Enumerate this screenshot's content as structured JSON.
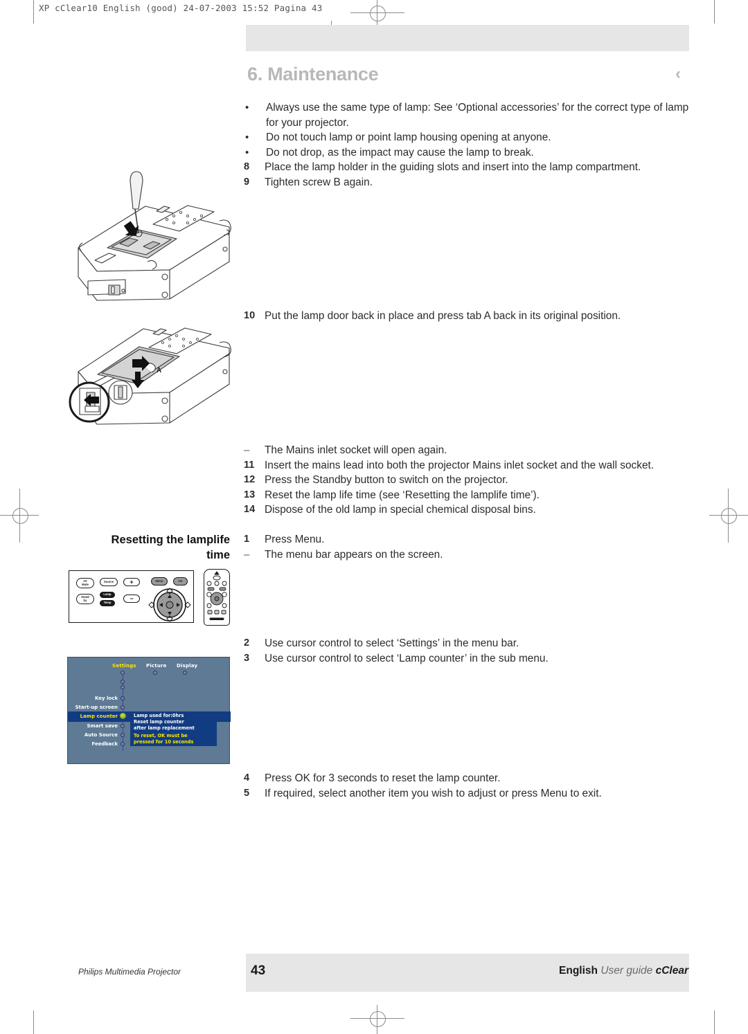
{
  "prepress": {
    "header": "XP cClear10 English (good)  24-07-2003  15:52  Pagina 43"
  },
  "chapter": {
    "title": "6. Maintenance",
    "arrow": "‹"
  },
  "steps_top": [
    {
      "marker": "•",
      "type": "bullet",
      "text": "Always use the same type of lamp: See ‘Optional accessories’ for the correct type of lamp for your projector."
    },
    {
      "marker": "•",
      "type": "bullet",
      "text": "Do not touch lamp or point lamp housing opening at anyone."
    },
    {
      "marker": "•",
      "type": "bullet",
      "text": "Do not drop, as the impact may cause the lamp to break."
    },
    {
      "marker": "8",
      "type": "num",
      "text": "Place the lamp holder in the guiding slots and insert into the lamp compartment."
    },
    {
      "marker": "9",
      "type": "num",
      "text": "Tighten screw B again."
    }
  ],
  "steps_mid": [
    {
      "marker": "10",
      "type": "num",
      "text": "Put the lamp door back in place and press tab A back in its original position."
    }
  ],
  "steps_lower": [
    {
      "marker": "–",
      "type": "dash",
      "text": "The Mains inlet socket will open again."
    },
    {
      "marker": "11",
      "type": "num",
      "text": "Insert the mains lead into both the projector Mains inlet socket and the wall socket."
    },
    {
      "marker": "12",
      "type": "num",
      "text": "Press the Standby button to switch on the projector."
    },
    {
      "marker": "13",
      "type": "num",
      "text": "Reset the lamp life time (see ‘Resetting the lamplife time’)."
    },
    {
      "marker": "14",
      "type": "num",
      "text": "Dispose of the old lamp in special chemical disposal bins."
    }
  ],
  "side_heading": {
    "line1": "Resetting the lamplife",
    "line2": "time"
  },
  "steps_reset_a": [
    {
      "marker": "1",
      "type": "num",
      "text": "Press Menu."
    },
    {
      "marker": "–",
      "type": "dash",
      "text": "The menu bar appears on the screen."
    }
  ],
  "steps_reset_b": [
    {
      "marker": "2",
      "type": "num",
      "text": "Use cursor control to select ‘Settings’ in the menu bar."
    },
    {
      "marker": "3",
      "type": "num",
      "text": "Use cursor control to select ‘Lamp counter’ in the sub menu."
    }
  ],
  "steps_reset_c": [
    {
      "marker": "4",
      "type": "num",
      "text": "Press OK for 3 seconds to reset the lamp counter."
    },
    {
      "marker": "5",
      "type": "num",
      "text": "If required, select another item you wish to adjust or press Menu to exit."
    }
  ],
  "osd": {
    "tabs": [
      {
        "label": "Settings",
        "selected": true
      },
      {
        "label": "Picture",
        "selected": false
      },
      {
        "label": "Display",
        "selected": false
      }
    ],
    "items": [
      {
        "label": "Key lock",
        "selected": false
      },
      {
        "label": "Start-up screen",
        "selected": false
      },
      {
        "label": "Lamp counter",
        "selected": true
      },
      {
        "label": "Smart save",
        "selected": false
      },
      {
        "label": "Auto Source",
        "selected": false
      },
      {
        "label": "Feedback",
        "selected": false
      }
    ],
    "panel": {
      "line1": "Lamp used for:0hrs",
      "line2": "Reset lamp counter",
      "line3": "after lamp replacement",
      "warn1": "To reset, OK must be",
      "warn2": "pressed for 10 seconds"
    },
    "colors": {
      "background": "#5e7a94",
      "panel": "#123c82",
      "highlight": "#ffe600",
      "text": "#ffffff"
    }
  },
  "keypad": {
    "buttons": [
      {
        "label": "AV\nMute"
      },
      {
        "label": "Stand\nby"
      },
      {
        "label": "Source"
      },
      {
        "label": "Lamp"
      },
      {
        "label": "Temp"
      },
      {
        "label": "+"
      },
      {
        "label": "−"
      },
      {
        "label": "Menu"
      },
      {
        "label": "OK"
      }
    ]
  },
  "illustration": {
    "tab_label": "A"
  },
  "footer": {
    "left": "Philips Multimedia Projector",
    "page": "43",
    "right_bold": "English",
    "right_italic": "User guide",
    "right_brand": "cClear"
  }
}
